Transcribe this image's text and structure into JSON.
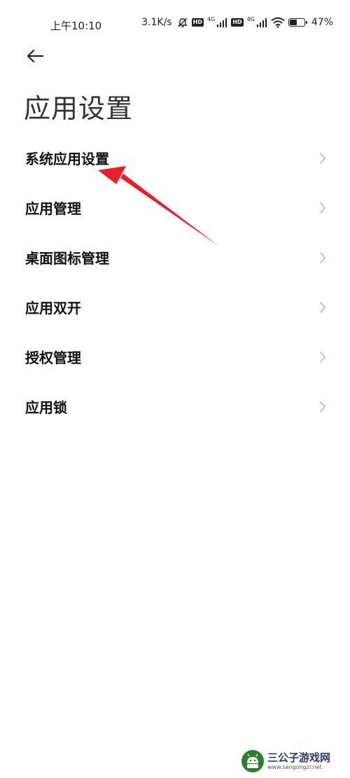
{
  "status_bar": {
    "time": "上午10:10",
    "net_speed": "3.1K/s",
    "sim1_network": "4G",
    "sim2_network": "4G",
    "hd_badge": "HD",
    "battery_percent": "47%",
    "battery_level": 0.47
  },
  "header": {
    "back_icon": "arrow-left-icon",
    "title": "应用设置"
  },
  "menu": {
    "items": [
      {
        "label": "系统应用设置",
        "icon": "chevron-right-icon"
      },
      {
        "label": "应用管理",
        "icon": "chevron-right-icon"
      },
      {
        "label": "桌面图标管理",
        "icon": "chevron-right-icon"
      },
      {
        "label": "应用双开",
        "icon": "chevron-right-icon"
      },
      {
        "label": "授权管理",
        "icon": "chevron-right-icon"
      },
      {
        "label": "应用锁",
        "icon": "chevron-right-icon"
      }
    ]
  },
  "annotation": {
    "color": "#e8202a",
    "points_to": "系统应用设置"
  },
  "watermark": {
    "title": "三公子游戏网",
    "url": "www.sangongzi.net"
  },
  "colors": {
    "background": "#ffffff",
    "text_primary": "#111111",
    "chevron": "#b3b3b3"
  }
}
